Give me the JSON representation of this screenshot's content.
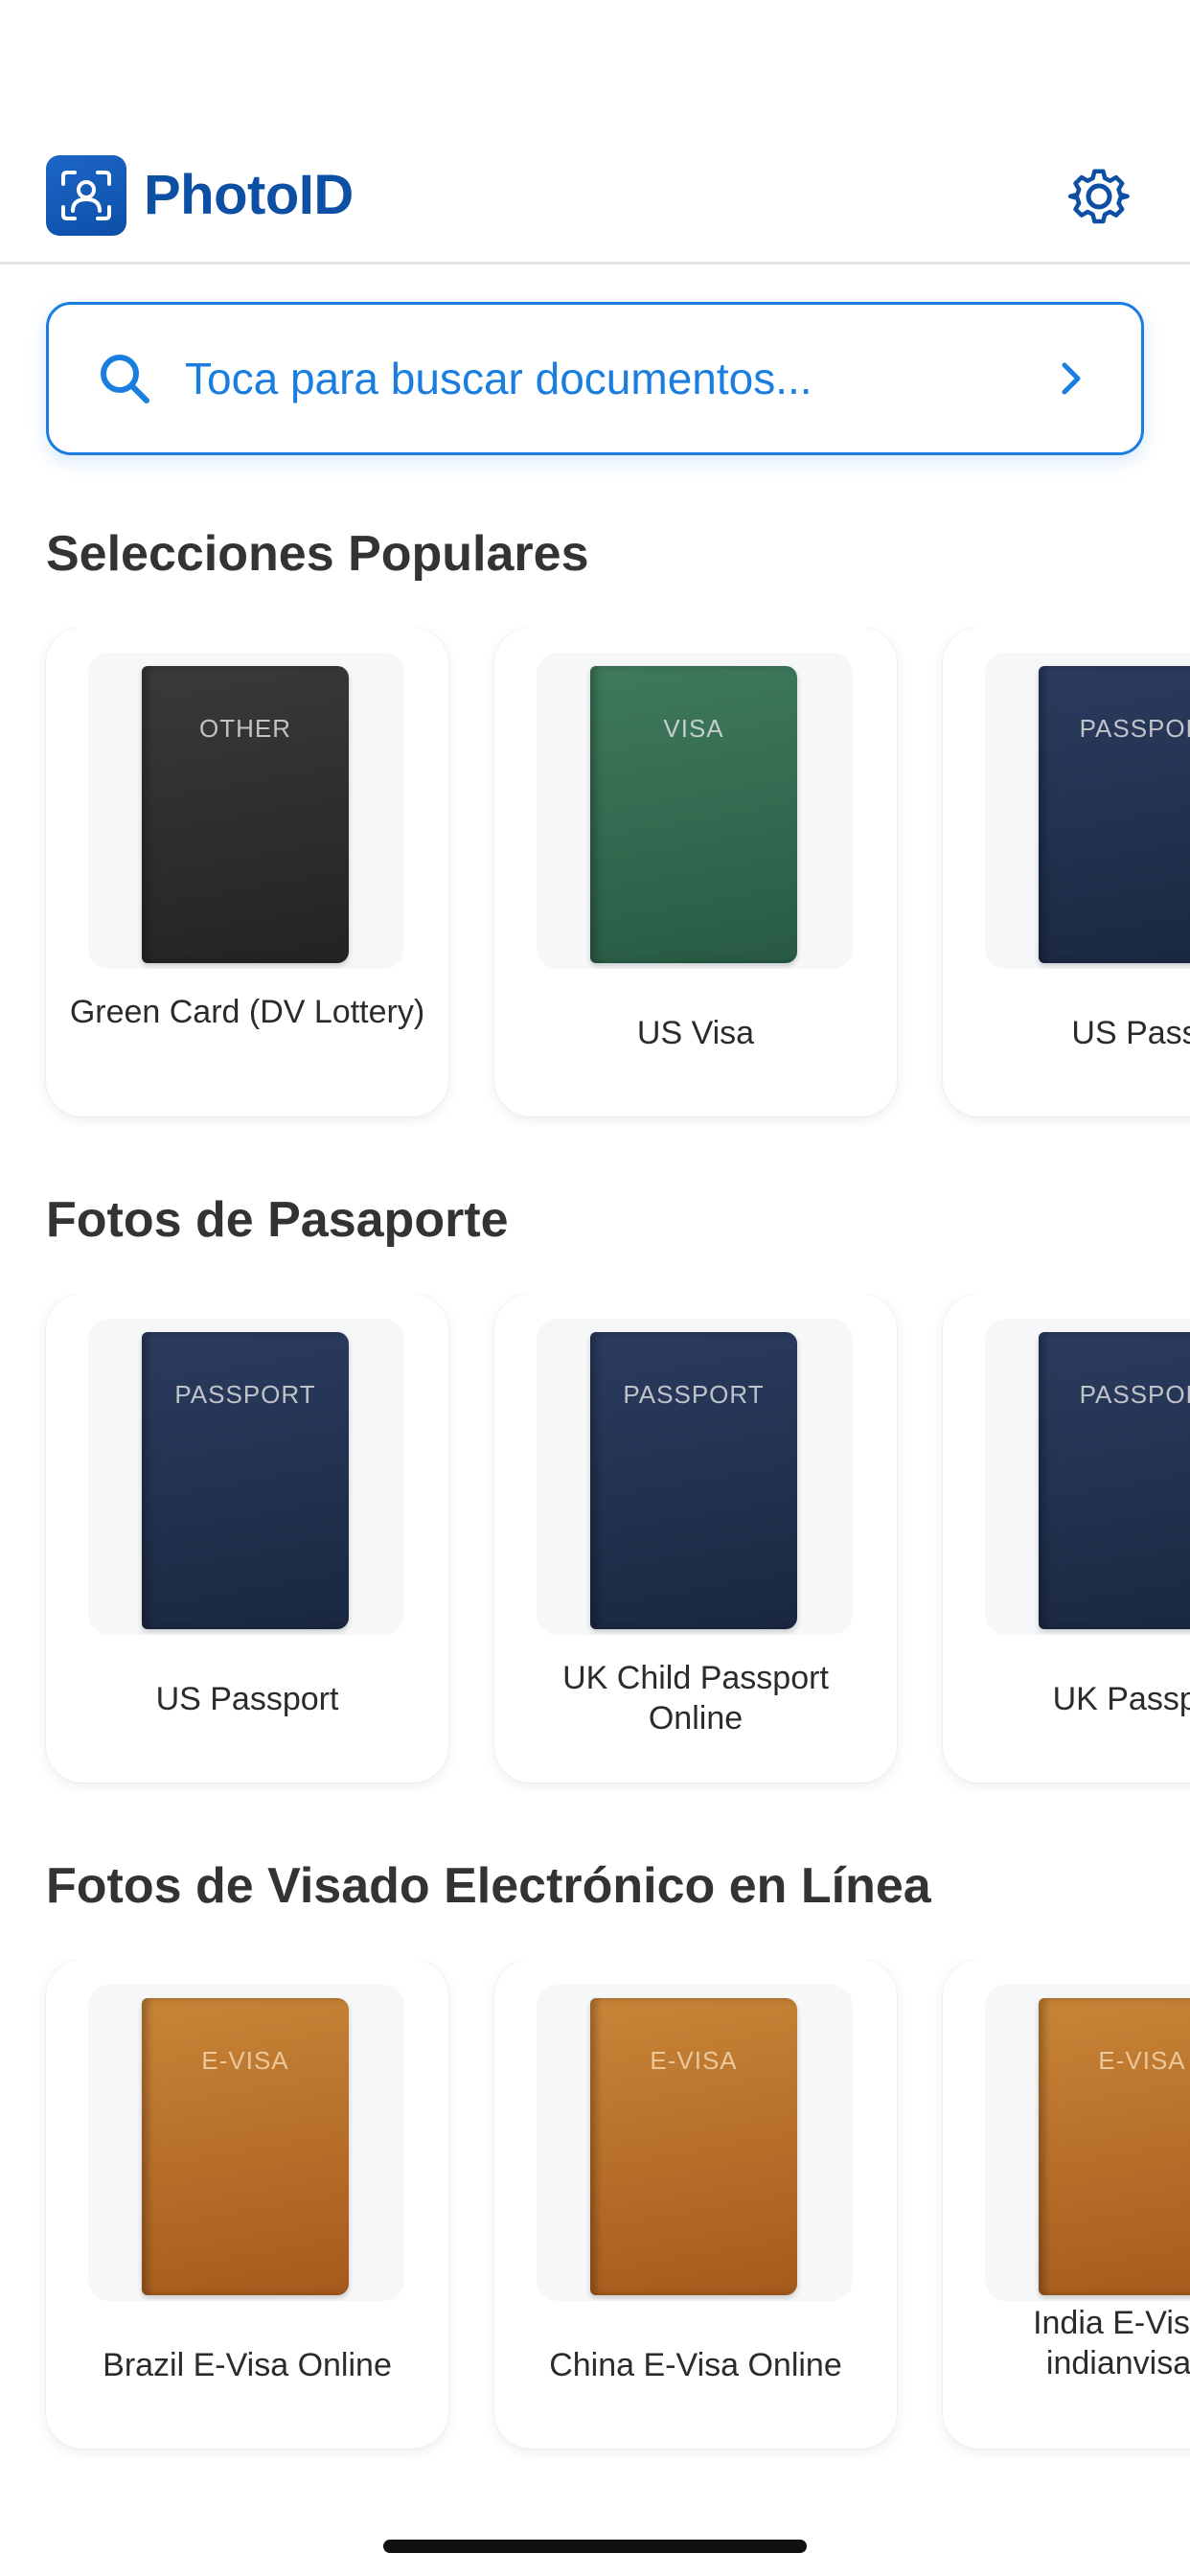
{
  "app": {
    "title": "PhotoID"
  },
  "search": {
    "placeholder": "Toca para buscar documentos..."
  },
  "sections": [
    {
      "title": "Selecciones Populares",
      "cards": [
        {
          "label": "Green Card (DV Lottery)",
          "cover": "OTHER",
          "color": "#2a2a2a"
        },
        {
          "label": "US Visa",
          "cover": "VISA",
          "color": "#2f6a4f"
        },
        {
          "label": "US Passp",
          "cover": "PASSPOR",
          "color": "#1f2e4c"
        }
      ]
    },
    {
      "title": "Fotos de Pasaporte",
      "cards": [
        {
          "label": "US Passport",
          "cover": "PASSPORT",
          "color": "#1f2e4c"
        },
        {
          "label": "UK Child Passport Online",
          "cover": "PASSPORT",
          "color": "#1f2e4c"
        },
        {
          "label": "UK Passport",
          "cover": "PASSPOR",
          "color": "#1f2e4c"
        }
      ]
    },
    {
      "title": "Fotos de Visado Electrónico en Línea",
      "cards": [
        {
          "label": "Brazil E-Visa Online",
          "cover": "E-VISA",
          "color": "#b56e2a"
        },
        {
          "label": "China E-Visa Online",
          "cover": "E-VISA",
          "color": "#b56e2a"
        },
        {
          "label": "India E-Visa for indianvisaonli",
          "cover": "E-VISA",
          "color": "#b56e2a"
        }
      ]
    }
  ]
}
